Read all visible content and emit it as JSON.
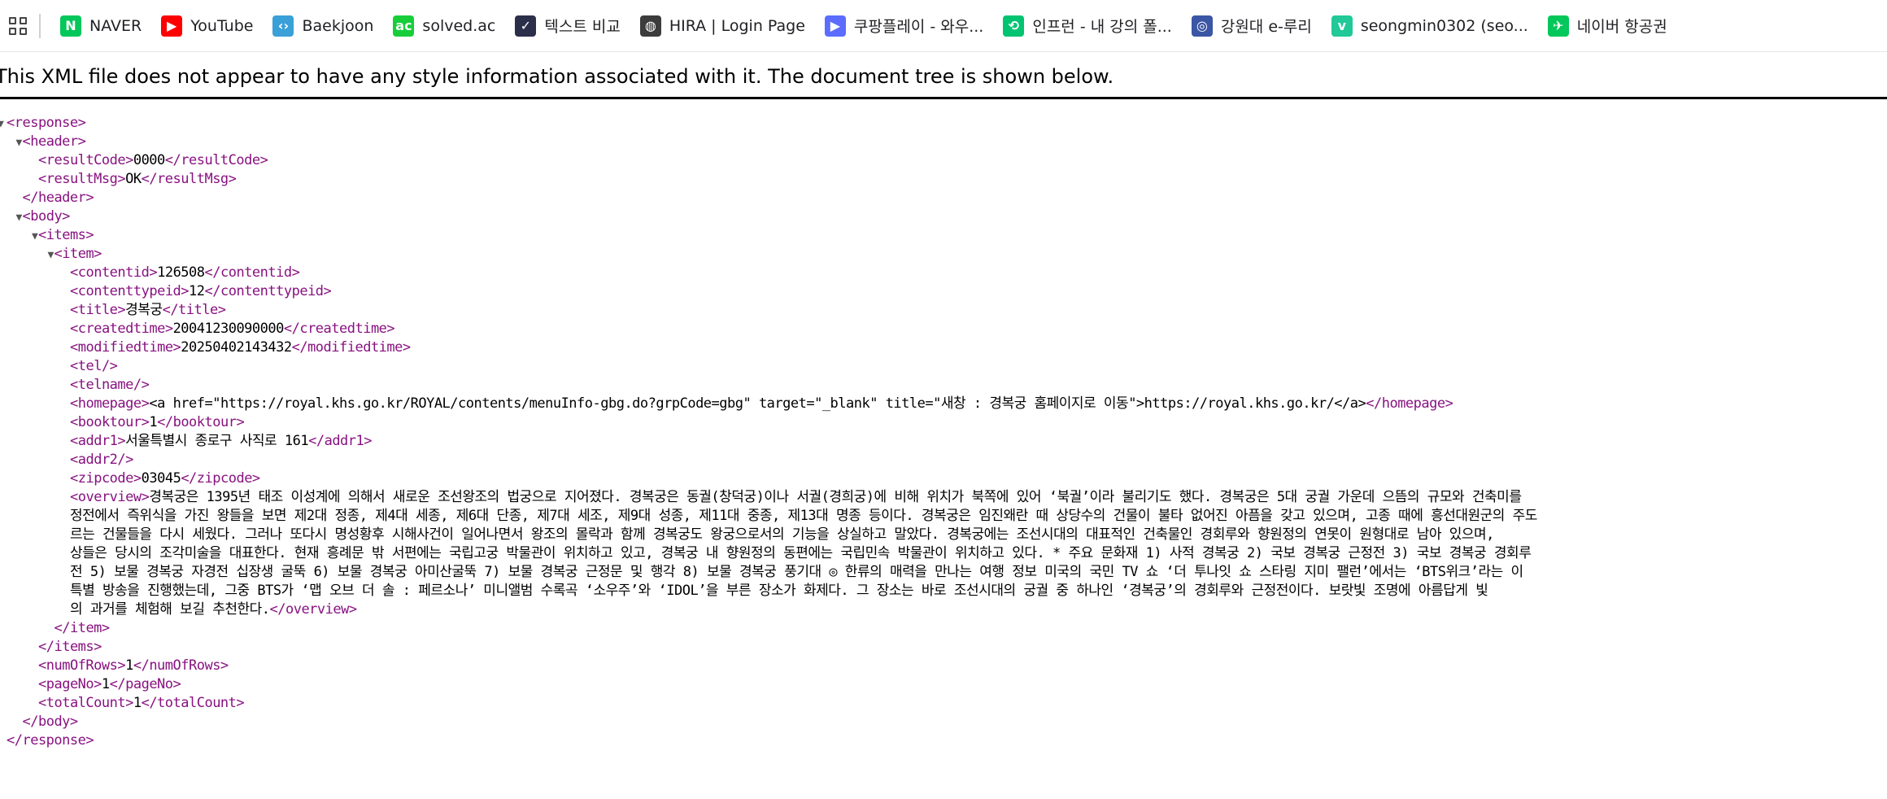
{
  "bookmarks": [
    {
      "label": "NAVER",
      "icon": "naver-icon",
      "color": "#03c75a",
      "glyph": "N"
    },
    {
      "label": "YouTube",
      "icon": "youtube-icon",
      "color": "#ff0000",
      "glyph": "▶"
    },
    {
      "label": "Baekjoon",
      "icon": "code-brackets-icon",
      "color": "#3aa0d8",
      "glyph": "‹›"
    },
    {
      "label": "solved.ac",
      "icon": "solved-ac-icon",
      "color": "#17ce3a",
      "glyph": "ac"
    },
    {
      "label": "텍스트 비교",
      "icon": "text-compare-icon",
      "color": "#2b2f4a",
      "glyph": "✓"
    },
    {
      "label": "HIRA | Login Page",
      "icon": "globe-icon",
      "color": "#3c3c3c",
      "glyph": "◍"
    },
    {
      "label": "쿠팡플레이 - 와우...",
      "icon": "coupang-play-icon",
      "color": "#5b6cff",
      "glyph": "▶"
    },
    {
      "label": "인프런 - 내 강의 폴...",
      "icon": "inflearn-icon",
      "color": "#00c471",
      "glyph": "⟲"
    },
    {
      "label": "강원대 e-루리",
      "icon": "kangwon-univ-icon",
      "color": "#3b56a5",
      "glyph": "◎"
    },
    {
      "label": "seongmin0302 (seo...",
      "icon": "velog-icon",
      "color": "#20c997",
      "glyph": "v"
    },
    {
      "label": "네이버 항공권",
      "icon": "naver-flight-icon",
      "color": "#03c75a",
      "glyph": "✈"
    }
  ],
  "notice": "This XML file does not appear to have any style information associated with it. The document tree is shown below.",
  "colors": {
    "tag": "#881280",
    "text": "#000000"
  },
  "xml_lines": [
    {
      "indent": 0,
      "toggle": "▼",
      "open": "<response>",
      "text": "",
      "close": ""
    },
    {
      "indent": 1,
      "toggle": "▼",
      "open": "<header>",
      "text": "",
      "close": ""
    },
    {
      "indent": 2,
      "toggle": "",
      "open": "<resultCode>",
      "text": "0000",
      "close": "</resultCode>"
    },
    {
      "indent": 2,
      "toggle": "",
      "open": "<resultMsg>",
      "text": "OK",
      "close": "</resultMsg>"
    },
    {
      "indent": 1,
      "toggle": "",
      "open": "</header>",
      "text": "",
      "close": ""
    },
    {
      "indent": 1,
      "toggle": "▼",
      "open": "<body>",
      "text": "",
      "close": ""
    },
    {
      "indent": 2,
      "toggle": "▼",
      "open": "<items>",
      "text": "",
      "close": ""
    },
    {
      "indent": 3,
      "toggle": "▼",
      "open": "<item>",
      "text": "",
      "close": ""
    },
    {
      "indent": 4,
      "toggle": "",
      "open": "<contentid>",
      "text": "126508",
      "close": "</contentid>"
    },
    {
      "indent": 4,
      "toggle": "",
      "open": "<contenttypeid>",
      "text": "12",
      "close": "</contenttypeid>"
    },
    {
      "indent": 4,
      "toggle": "",
      "open": "<title>",
      "text": "경복궁",
      "close": "</title>"
    },
    {
      "indent": 4,
      "toggle": "",
      "open": "<createdtime>",
      "text": "20041230090000",
      "close": "</createdtime>"
    },
    {
      "indent": 4,
      "toggle": "",
      "open": "<modifiedtime>",
      "text": "20250402143432",
      "close": "</modifiedtime>"
    },
    {
      "indent": 4,
      "toggle": "",
      "open": "<tel/>",
      "text": "",
      "close": ""
    },
    {
      "indent": 4,
      "toggle": "",
      "open": "<telname/>",
      "text": "",
      "close": ""
    },
    {
      "indent": 4,
      "toggle": "",
      "open": "<homepage>",
      "text": "<a href=\"https://royal.khs.go.kr/ROYAL/contents/menuInfo-gbg.do?grpCode=gbg\" target=\"_blank\" title=\"새창 : 경복궁 홈페이지로 이동\">https://royal.khs.go.kr/</a>",
      "close": "</homepage>"
    },
    {
      "indent": 4,
      "toggle": "",
      "open": "<booktour>",
      "text": "1",
      "close": "</booktour>"
    },
    {
      "indent": 4,
      "toggle": "",
      "open": "<addr1>",
      "text": "서울특별시 종로구 사직로 161",
      "close": "</addr1>"
    },
    {
      "indent": 4,
      "toggle": "",
      "open": "<addr2/>",
      "text": "",
      "close": ""
    },
    {
      "indent": 4,
      "toggle": "",
      "open": "<zipcode>",
      "text": "03045",
      "close": "</zipcode>"
    },
    {
      "indent": 4,
      "toggle": "",
      "open": "<overview>",
      "text": "경복궁은 1395년 태조 이성계에 의해서 새로운 조선왕조의 법궁으로 지어졌다. 경복궁은 동궐(창덕궁)이나 서궐(경희궁)에 비해 위치가 북쪽에 있어 ‘북궐’이라 불리기도 했다. 경복궁은 5대 궁궐 가운데 으뜸의 규모와 건축미를",
      "close": ""
    },
    {
      "indent": 4,
      "toggle": "",
      "open": "",
      "text": "정전에서 즉위식을 가진 왕들을 보면 제2대 정종, 제4대 세종, 제6대 단종, 제7대 세조, 제9대 성종, 제11대 중종, 제13대 명종 등이다. 경복궁은 임진왜란 때 상당수의 건물이 불타 없어진 아픔을 갖고 있으며, 고종 때에 흥선대원군의 주도",
      "close": ""
    },
    {
      "indent": 4,
      "toggle": "",
      "open": "",
      "text": "르는 건물들을 다시 세웠다. 그러나 또다시 명성황후 시해사건이 일어나면서 왕조의 몰락과 함께 경복궁도 왕궁으로서의 기능을 상실하고 말았다. 경복궁에는 조선시대의 대표적인 건축물인 경회루와 향원정의 연못이 원형대로 남아 있으며,",
      "close": ""
    },
    {
      "indent": 4,
      "toggle": "",
      "open": "",
      "text": "상들은 당시의 조각미술을 대표한다. 현재 흥례문 밖 서편에는 국립고궁 박물관이 위치하고 있고, 경복궁 내 향원정의 동편에는 국립민속 박물관이 위치하고 있다. * 주요 문화재 1) 사적 경복궁 2) 국보 경복궁 근정전 3) 국보 경복궁 경회루",
      "close": ""
    },
    {
      "indent": 4,
      "toggle": "",
      "open": "",
      "text": "전 5) 보물 경복궁 자경전 십장생 굴뚝 6) 보물 경복궁 아미산굴뚝 7) 보물 경복궁 근정문 및 행각 8) 보물 경복궁 풍기대 ◎ 한류의 매력을 만나는 여행 정보 미국의 국민 TV 쇼 ‘더 투나잇 쇼 스타링 지미 팰런’에서는 ‘BTS위크’라는 이",
      "close": ""
    },
    {
      "indent": 4,
      "toggle": "",
      "open": "",
      "text": "특별 방송을 진행했는데, 그중 BTS가 ‘맵 오브 더 솔 : 페르소나’ 미니앨범 수록곡 ‘소우주’와 ‘IDOL’을 부른 장소가 화제다. 그 장소는 바로 조선시대의 궁궐 중 하나인 ‘경복궁’의 경회루와 근정전이다. 보랏빛 조명에 아름답게 빛",
      "close": ""
    },
    {
      "indent": 4,
      "toggle": "",
      "open": "",
      "text": "의 과거를 체험해 보길 추천한다.",
      "close": "</overview>"
    },
    {
      "indent": 3,
      "toggle": "",
      "open": "</item>",
      "text": "",
      "close": ""
    },
    {
      "indent": 2,
      "toggle": "",
      "open": "</items>",
      "text": "",
      "close": ""
    },
    {
      "indent": 2,
      "toggle": "",
      "open": "<numOfRows>",
      "text": "1",
      "close": "</numOfRows>"
    },
    {
      "indent": 2,
      "toggle": "",
      "open": "<pageNo>",
      "text": "1",
      "close": "</pageNo>"
    },
    {
      "indent": 2,
      "toggle": "",
      "open": "<totalCount>",
      "text": "1",
      "close": "</totalCount>"
    },
    {
      "indent": 1,
      "toggle": "",
      "open": "</body>",
      "text": "",
      "close": ""
    },
    {
      "indent": 0,
      "toggle": "",
      "open": "</response>",
      "text": "",
      "close": ""
    }
  ]
}
